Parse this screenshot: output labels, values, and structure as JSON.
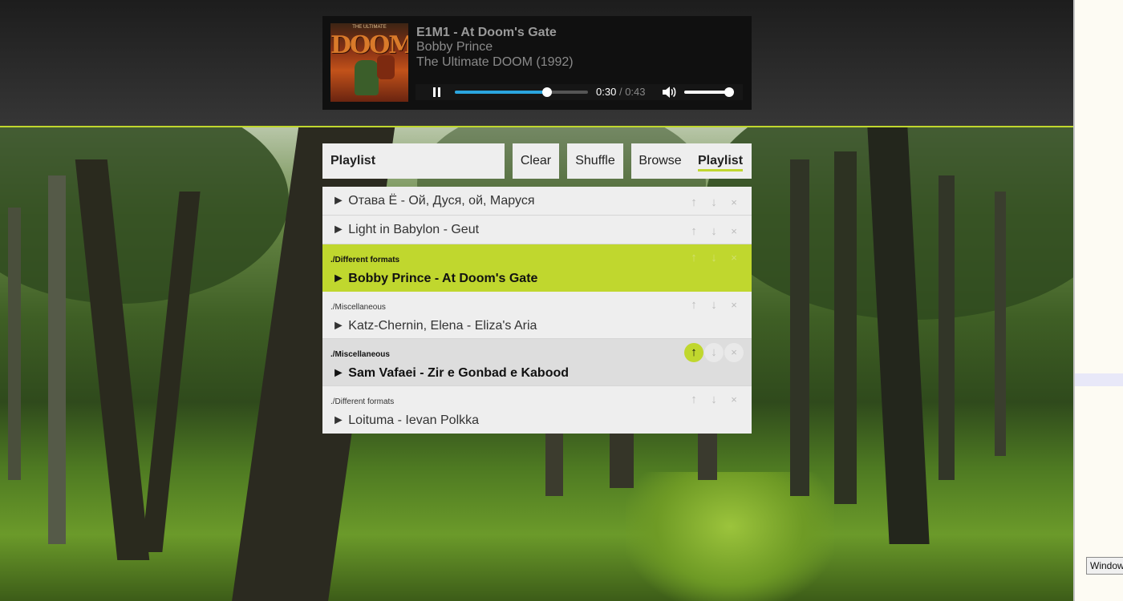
{
  "player": {
    "title": "E1M1 - At Doom's Gate",
    "artist": "Bobby Prince",
    "album": "The Ultimate DOOM (1992)",
    "cover_text": "THE ULTIMATE",
    "cover_logo": "DOOM",
    "elapsed": "0:30",
    "separator": "/",
    "duration": "0:43",
    "progress_fraction": 0.69,
    "volume_fraction": 1.0
  },
  "toolbar": {
    "playlist_name": "Playlist",
    "clear_label": "Clear",
    "shuffle_label": "Shuffle",
    "browse_label": "Browse",
    "playlist_label": "Playlist"
  },
  "playlist": [
    {
      "folder": "",
      "title": "► Отава Ё - Ой, Дуся, ой, Маруся"
    },
    {
      "folder": "",
      "title": "► Light in Babylon - Geut"
    },
    {
      "folder": "./Different formats",
      "title": "► Bobby Prince - At Doom's Gate"
    },
    {
      "folder": "./Miscellaneous",
      "title": "► Katz-Chernin, Elena - Eliza's Aria"
    },
    {
      "folder": "./Miscellaneous",
      "title": "► Sam Vafaei - Zir e Gonbad e Kabood"
    },
    {
      "folder": "./Different formats",
      "title": "► Loituma - Ievan Polkka"
    }
  ],
  "actions": {
    "up": "↑",
    "down": "↓",
    "remove": "×"
  },
  "taskbar": {
    "label": "Window"
  },
  "colors": {
    "accent": "#c0d72e",
    "progress": "#2ba6e0"
  }
}
